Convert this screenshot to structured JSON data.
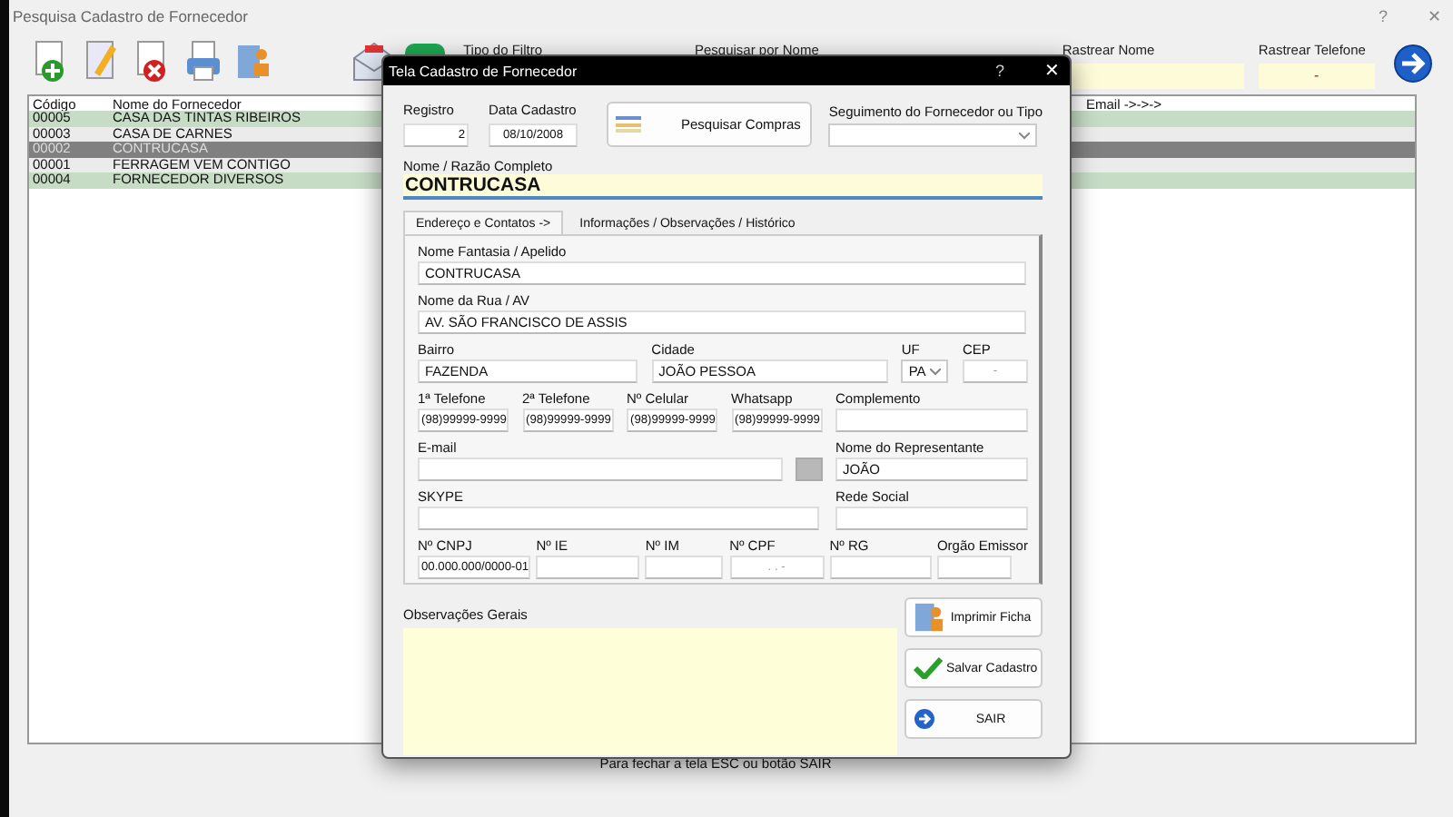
{
  "window": {
    "title": "Pesquisa Cadastro de Fornecedor",
    "help": "?",
    "close": "✕"
  },
  "filters": [
    {
      "label": "Tipo do Filtro",
      "kind": "label"
    },
    {
      "label": "Pesquisar por Nome",
      "kind": "label"
    },
    {
      "label": "Rastrear Nome",
      "kind": "field"
    },
    {
      "label": "Rastrear Telefone",
      "kind": "field",
      "value": "-"
    }
  ],
  "list": {
    "columns": [
      "Código",
      "Nome do Fornecedor",
      "Email ->->->"
    ],
    "rows": [
      {
        "code": "00005",
        "name": "CASA DAS TINTAS RIBEIROS",
        "selected": false,
        "color": "#c6dcc5"
      },
      {
        "code": "00003",
        "name": "CASA DE CARNES",
        "selected": false,
        "color": "#ebebeb"
      },
      {
        "code": "00002",
        "name": "CONTRUCASA",
        "selected": true,
        "color": "#808080"
      },
      {
        "code": "00001",
        "name": "FERRAGEM VEM CONTIGO",
        "selected": false,
        "color": "#ebebeb"
      },
      {
        "code": "00004",
        "name": "FORNECEDOR DIVERSOS",
        "selected": false,
        "color": "#c6dcc5"
      }
    ]
  },
  "hint": "Para fechar a tela ESC ou botão SAIR",
  "dialog": {
    "title": "Tela Cadastro de Fornecedor",
    "help": "?",
    "close": "✕",
    "registro": {
      "label": "Registro",
      "value": "2"
    },
    "data_cadastro": {
      "label": "Data Cadastro",
      "value": "08/10/2008"
    },
    "search_button": "Pesquisar Compras",
    "segment": {
      "label": "Seguimento do Fornecedor ou Tipo"
    },
    "nome": {
      "label": "Nome / Razão Completo",
      "value": "CONTRUCASA"
    },
    "tabs": [
      {
        "label": "Endereço e Contatos ->",
        "selected": true
      },
      {
        "label": "Informações / Observações / Histórico",
        "selected": false
      }
    ],
    "form_rows": [
      [
        {
          "kind": "text",
          "label": "Nome Fantasia / Apelido",
          "value": "CONTRUCASA"
        }
      ],
      [
        {
          "kind": "text",
          "label": "Nome da Rua / AV",
          "value": "AV. SÃO FRANCISCO DE ASSIS"
        }
      ],
      [
        {
          "kind": "text",
          "label": "Bairro",
          "value": "FAZENDA"
        },
        {
          "kind": "text",
          "label": "Cidade",
          "value": "JOÃO PESSOA"
        },
        {
          "kind": "select",
          "label": "UF",
          "value": "PA"
        },
        {
          "kind": "mask",
          "label": "CEP",
          "placeholder": "-"
        }
      ],
      [
        {
          "kind": "text",
          "label": "1ª Telefone",
          "value": "(98)99999-9999"
        },
        {
          "kind": "text",
          "label": "2ª Telefone",
          "value": "(98)99999-9999"
        },
        {
          "kind": "text",
          "label": "Nº Celular",
          "value": "(98)99999-9999"
        },
        {
          "kind": "text",
          "label": "Whatsapp",
          "value": "(98)99999-9999"
        },
        {
          "kind": "text",
          "label": "Complemento"
        }
      ],
      [
        {
          "kind": "text",
          "label": "E-mail"
        },
        {
          "kind": "icon-button"
        },
        {
          "kind": "text",
          "label": "Nome do Representante",
          "value": "JOÃO"
        }
      ],
      [
        {
          "kind": "text",
          "label": "SKYPE"
        },
        {
          "kind": "text",
          "label": "Rede Social"
        }
      ],
      [
        {
          "kind": "text",
          "label": "Nº CNPJ",
          "value": "00.000.000/0000-01"
        },
        {
          "kind": "text",
          "label": "Nº IE"
        },
        {
          "kind": "text",
          "label": "Nº IM"
        },
        {
          "kind": "mask",
          "label": "Nº CPF",
          "placeholder": ".   .   -"
        },
        {
          "kind": "text",
          "label": "Nº RG"
        },
        {
          "kind": "text",
          "label": "Orgão Emissor"
        }
      ]
    ],
    "notes": {
      "label": "Observações Gerais"
    },
    "actions": [
      {
        "label": "Imprimir Ficha",
        "kind": "print"
      },
      {
        "label": "Salvar Cadastro",
        "kind": "save"
      },
      {
        "label": "SAIR",
        "kind": "exit"
      }
    ]
  }
}
